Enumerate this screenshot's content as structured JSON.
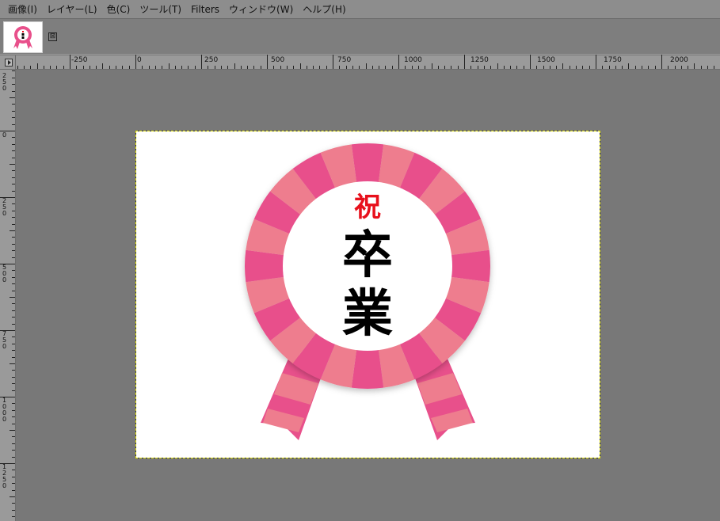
{
  "menubar": {
    "items": [
      "画像(I)",
      "レイヤー(L)",
      "色(C)",
      "ツール(T)",
      "Filters",
      "ウィンドウ(W)",
      "ヘルプ(H)"
    ]
  },
  "tabs": {
    "close_glyph": "⊠"
  },
  "rulers": {
    "horizontal_labels": [
      "-250",
      "0",
      "250",
      "500",
      "750",
      "1000",
      "1250",
      "1500",
      "1750",
      "2000"
    ],
    "vertical_labels": [
      "250",
      "0",
      "250",
      "500",
      "750",
      "1000",
      "1250"
    ]
  },
  "artwork": {
    "top_text": "祝",
    "middle_text": "卒",
    "bottom_text": "業",
    "colors": {
      "dark_pink": "#e8508b",
      "light_pink": "#ee7d8e",
      "top_text_red": "#e8101c",
      "text_black": "#000000"
    }
  }
}
